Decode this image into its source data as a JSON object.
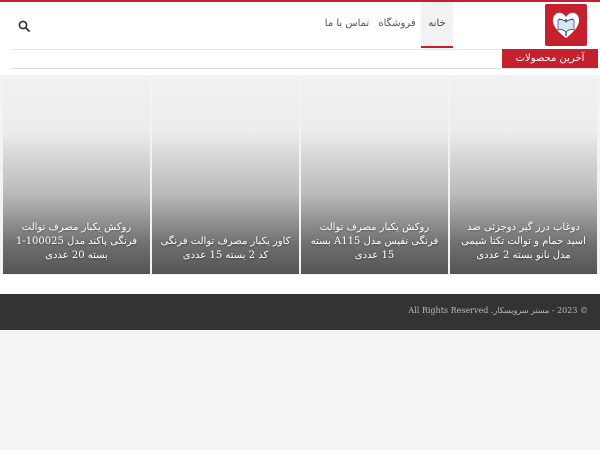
{
  "colors": {
    "brand": "#c5202e",
    "footer_bg": "#333333"
  },
  "header": {
    "logo_icon": "heart-book-icon",
    "search_icon": "search-icon",
    "nav": [
      {
        "label": "خانه",
        "active": true
      },
      {
        "label": "فروشگاه",
        "active": false
      },
      {
        "label": "تماس با ما",
        "active": false
      }
    ]
  },
  "section": {
    "title": "آخرین محصولات"
  },
  "products": [
    {
      "title": "دوغاب درز گیر دوجزئی ضد اسید حمام و توالت تکتا شیمی مدل نانو بسته 2 عددی"
    },
    {
      "title": "روکش یکبار مصرف توالت فرنگی نفیس مدل A115 بسته 15 عددی"
    },
    {
      "title": "کاور یکبار مصرف توالت فرنگی کد 2 بسته 15 عددی"
    },
    {
      "title": "روکش یکبار مصرف توالت فرنگی پاکند مدل 100025-1 بسته 20 عددی"
    }
  ],
  "footer": {
    "copyright": "© 2023 - مستر سرویسکار. All Rights Reserved"
  }
}
